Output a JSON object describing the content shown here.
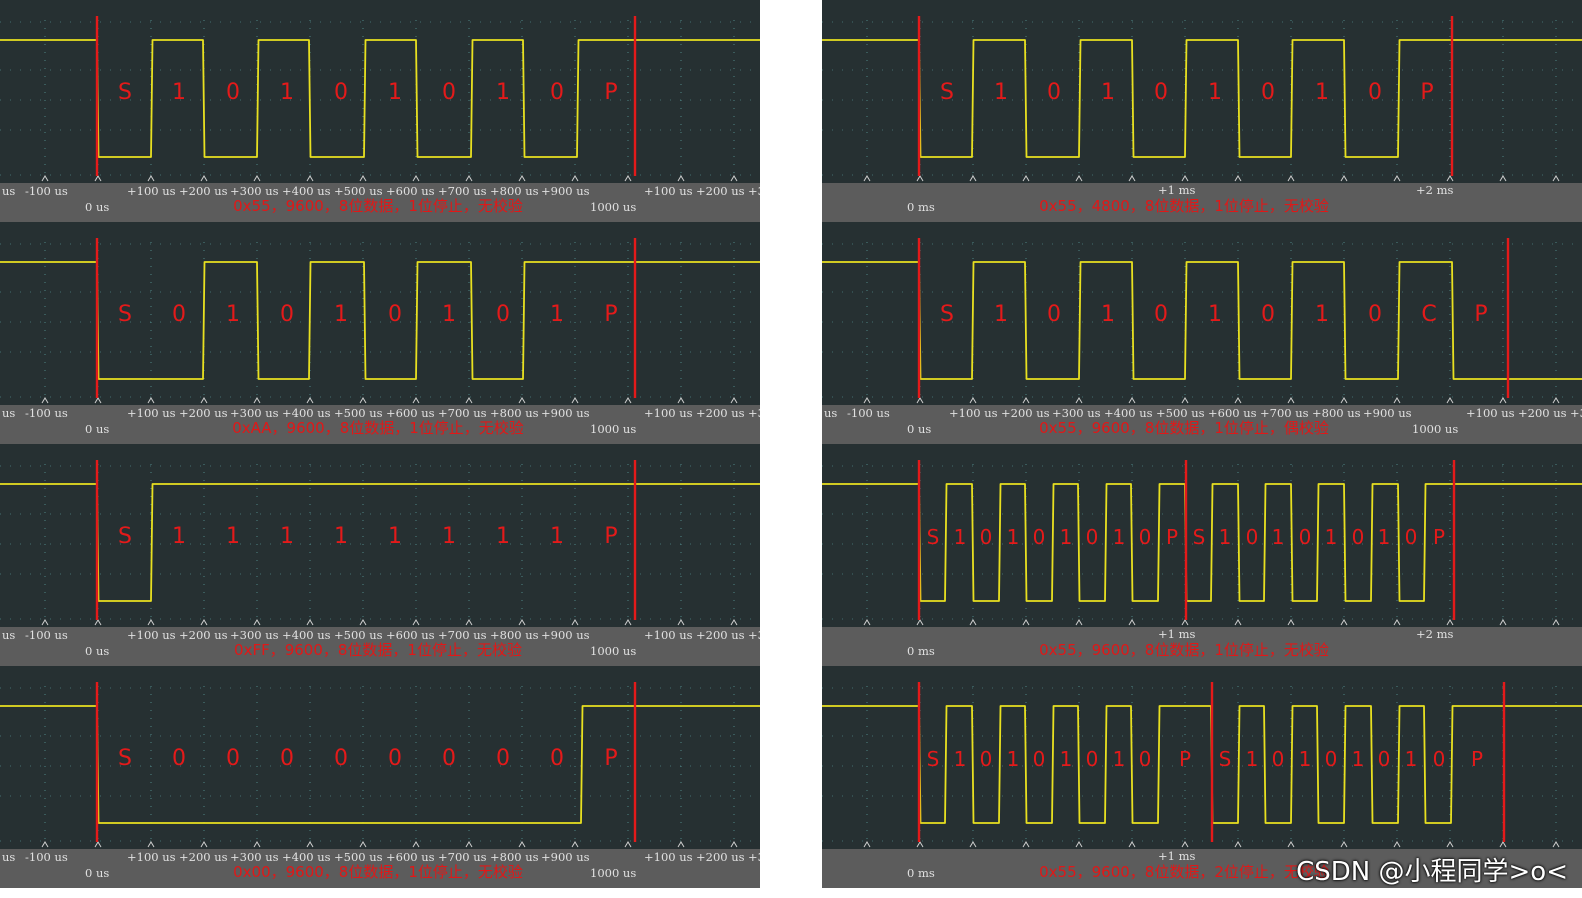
{
  "colors": {
    "background": "#263032",
    "axis_band": "#5c5c5c",
    "signal": "#e8e020",
    "marker": "#e41a1a",
    "grid": "#5aa0a0",
    "caption": "#e01818"
  },
  "left_axis_labels": [
    "us",
    "-100 us",
    "+100 us",
    "+200 us",
    "+300 us",
    "+400 us",
    "+500 us",
    "+600 us",
    "+700 us",
    "+800 us",
    "+900 us",
    "+100 us",
    "+200 us",
    "+3"
  ],
  "left_axis_origin": "0 us",
  "left_axis_end": "1000 us",
  "watermark": "CSDN @小程同学>o<",
  "panels": [
    {
      "caption": "0x55，9600，8位数据，1位停止，无校验",
      "bits": [
        "S",
        "1",
        "0",
        "1",
        "0",
        "1",
        "0",
        "1",
        "0",
        "P"
      ]
    },
    {
      "caption": "0xAA，9600，8位数据，1位停止，无校验",
      "bits": [
        "S",
        "0",
        "1",
        "0",
        "1",
        "0",
        "1",
        "0",
        "1",
        "P"
      ]
    },
    {
      "caption": "0xFF，9600，8位数据，1位停止，无校验",
      "bits": [
        "S",
        "1",
        "1",
        "1",
        "1",
        "1",
        "1",
        "1",
        "1",
        "P"
      ]
    },
    {
      "caption": "0x00，9600，8位数据，1位停止，无校验",
      "bits": [
        "S",
        "0",
        "0",
        "0",
        "0",
        "0",
        "0",
        "0",
        "0",
        "P"
      ]
    },
    {
      "caption": "0x55，4800，8位数据，1位停止，无校验",
      "bits": [
        "S",
        "1",
        "0",
        "1",
        "0",
        "1",
        "0",
        "1",
        "0",
        "P"
      ],
      "axis_ticks": [
        "+1 ms",
        "+2 ms"
      ],
      "axis_origin": "0 ms"
    },
    {
      "caption": "0x55，9600，8位数据，1位停止，偶校验",
      "bits": [
        "S",
        "1",
        "0",
        "1",
        "0",
        "1",
        "0",
        "1",
        "0",
        "C",
        "P"
      ],
      "axis_labels": [
        "us",
        "-100 us",
        "+100 us",
        "+200 us",
        "+300 us",
        "+400 us",
        "+500 us",
        "+600 us",
        "+700 us",
        "+800 us",
        "+900 us",
        "+100 us",
        "+200 us",
        "+3"
      ],
      "axis_origin": "0 us",
      "axis_end": "1000 us"
    },
    {
      "caption": "0x55，9600，8位数据，1位停止，无校验",
      "bits": [
        "S",
        "1",
        "0",
        "1",
        "0",
        "1",
        "0",
        "1",
        "0",
        "P",
        "S",
        "1",
        "0",
        "1",
        "0",
        "1",
        "0",
        "1",
        "0",
        "P"
      ],
      "axis_ticks": [
        "+1 ms",
        "+2 ms"
      ],
      "axis_origin": "0 ms"
    },
    {
      "caption": "0x55，9600，8位数据，2位停止，无校验",
      "bits": [
        "S",
        "1",
        "0",
        "1",
        "0",
        "1",
        "0",
        "1",
        "0",
        "P",
        "S",
        "1",
        "0",
        "1",
        "0",
        "1",
        "0",
        "1",
        "0",
        "P"
      ],
      "axis_ticks": [
        "+1 ms"
      ],
      "axis_origin": "0 ms"
    }
  ]
}
